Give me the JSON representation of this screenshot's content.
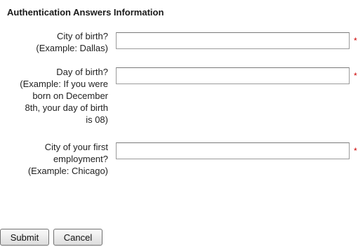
{
  "section_title": "Authentication Answers Information",
  "fields": [
    {
      "label_lines": [
        "City of birth?",
        "(Example: Dallas)"
      ],
      "value": "",
      "required_mark": "*"
    },
    {
      "label_lines": [
        "Day of birth?",
        "(Example: If you were",
        "born on December",
        "8th, your day of birth",
        "is 08)"
      ],
      "value": "",
      "required_mark": "*"
    },
    {
      "label_lines": [
        "City of your first",
        "employment?",
        "(Example: Chicago)"
      ],
      "value": "",
      "required_mark": "*"
    }
  ],
  "buttons": {
    "submit_label": "Submit",
    "cancel_label": "Cancel"
  },
  "colors": {
    "required": "#cc0000",
    "border": "#9b9b9b"
  }
}
